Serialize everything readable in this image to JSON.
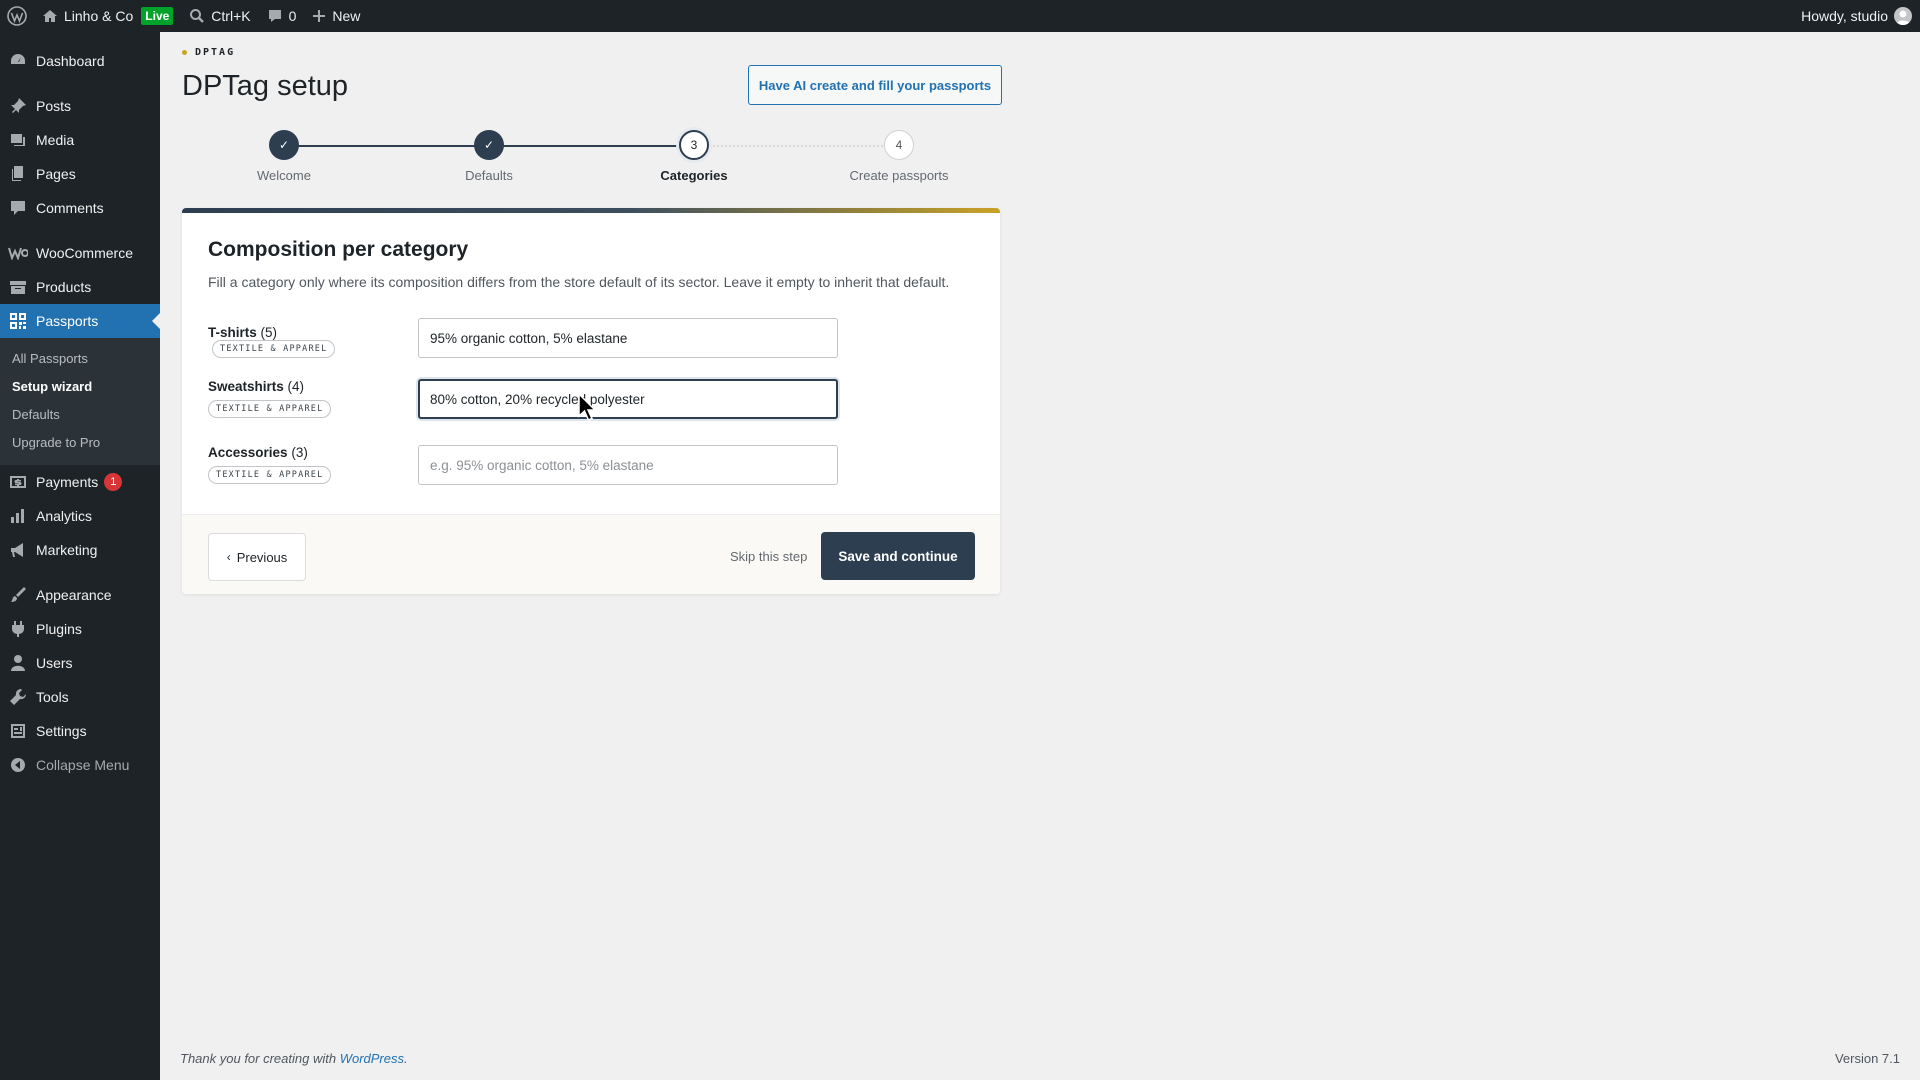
{
  "adminbar": {
    "site_name": "Linho & Co",
    "live_badge": "Live",
    "search_shortcut": "Ctrl+K",
    "comments_count": "0",
    "new_label": "New",
    "greeting": "Howdy, studio"
  },
  "sidebar": {
    "items": [
      {
        "label": "Dashboard",
        "icon": "dashboard-icon"
      },
      {
        "label": "Posts",
        "icon": "pin-icon"
      },
      {
        "label": "Media",
        "icon": "media-icon"
      },
      {
        "label": "Pages",
        "icon": "pages-icon"
      },
      {
        "label": "Comments",
        "icon": "comment-icon"
      },
      {
        "label": "WooCommerce",
        "icon": "woo-icon"
      },
      {
        "label": "Products",
        "icon": "archive-icon"
      },
      {
        "label": "Passports",
        "icon": "qr-icon"
      },
      {
        "label": "Payments",
        "icon": "dollar-icon",
        "badge": "1"
      },
      {
        "label": "Analytics",
        "icon": "chart-icon"
      },
      {
        "label": "Marketing",
        "icon": "megaphone-icon"
      },
      {
        "label": "Appearance",
        "icon": "brush-icon"
      },
      {
        "label": "Plugins",
        "icon": "plugin-icon"
      },
      {
        "label": "Users",
        "icon": "user-icon"
      },
      {
        "label": "Tools",
        "icon": "wrench-icon"
      },
      {
        "label": "Settings",
        "icon": "settings-icon"
      },
      {
        "label": "Collapse Menu",
        "icon": "collapse-icon"
      }
    ],
    "submenu": [
      {
        "label": "All Passports"
      },
      {
        "label": "Setup wizard"
      },
      {
        "label": "Defaults"
      },
      {
        "label": "Upgrade to Pro"
      }
    ]
  },
  "page": {
    "eyebrow": "DPTAG",
    "title": "DPTag setup",
    "ai_button": "Have AI create and fill your passports"
  },
  "stepper": {
    "steps": [
      {
        "label": "Welcome",
        "state": "done",
        "marker": "✓"
      },
      {
        "label": "Defaults",
        "state": "done",
        "marker": "✓"
      },
      {
        "label": "Categories",
        "state": "active",
        "marker": "3"
      },
      {
        "label": "Create passports",
        "state": "todo",
        "marker": "4"
      }
    ]
  },
  "card": {
    "title": "Composition per category",
    "description": "Fill a category only where its composition differs from the store default of its sector. Leave it empty to inherit that default.",
    "rows": [
      {
        "name": "T-shirts",
        "count": "(5)",
        "sector": "TEXTILE & APPAREL",
        "value": "95% organic cotton, 5% elastane",
        "placeholder": ""
      },
      {
        "name": "Sweatshirts",
        "count": "(4)",
        "sector": "TEXTILE & APPAREL",
        "value": "80% cotton, 20% recycled polyester",
        "placeholder": ""
      },
      {
        "name": "Accessories",
        "count": "(3)",
        "sector": "TEXTILE & APPAREL",
        "value": "",
        "placeholder": "e.g. 95% organic cotton, 5% elastane"
      }
    ],
    "previous_button": "Previous",
    "previous_chevron": "‹",
    "skip_link": "Skip this step",
    "save_button": "Save and continue"
  },
  "footer": {
    "thanks_prefix": "Thank you for creating with ",
    "thanks_link": "WordPress",
    "thanks_suffix": ".",
    "version": "Version 7.1"
  },
  "colors": {
    "accent_navy": "#2c3e50",
    "accent_gold": "#c9a227",
    "wp_blue": "#2271b1",
    "admin_dark": "#1d2327"
  }
}
